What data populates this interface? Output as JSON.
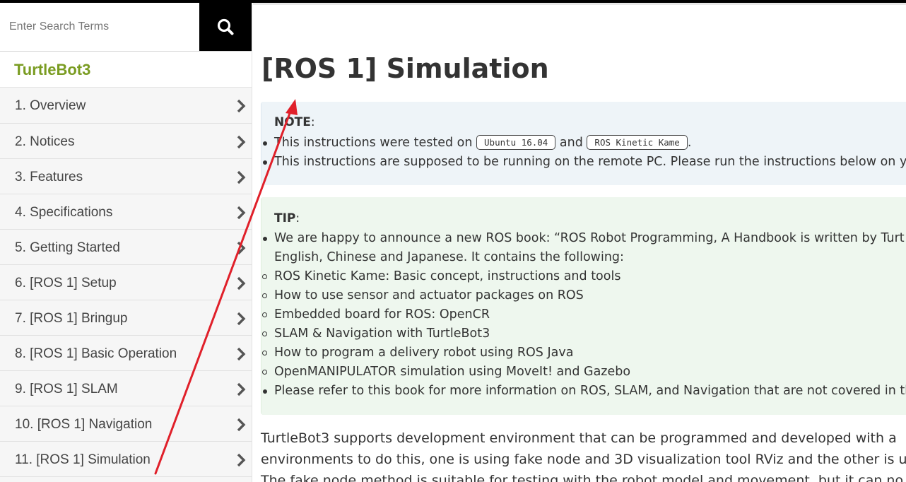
{
  "search": {
    "placeholder": "Enter Search Terms",
    "icon": "search-icon"
  },
  "sidebar": {
    "brand": "TurtleBot3",
    "items": [
      {
        "label": "1. Overview"
      },
      {
        "label": "2. Notices"
      },
      {
        "label": "3. Features"
      },
      {
        "label": "4. Specifications"
      },
      {
        "label": "5. Getting Started"
      },
      {
        "label": "6. [ROS 1] Setup"
      },
      {
        "label": "7. [ROS 1] Bringup"
      },
      {
        "label": "8. [ROS 1] Basic Operation"
      },
      {
        "label": "9. [ROS 1] SLAM"
      },
      {
        "label": "10. [ROS 1] Navigation"
      },
      {
        "label": "11. [ROS 1] Simulation"
      }
    ]
  },
  "main": {
    "title": "[ROS 1] Simulation",
    "note": {
      "heading": "NOTE",
      "line1_pre": "This instructions were tested on",
      "code1": "Ubuntu 16.04",
      "line1_mid": "and",
      "code2": "ROS Kinetic Kame",
      "line1_post": ".",
      "line2": "This instructions are supposed to be running on the remote PC. Please run the instructions below on you"
    },
    "tip": {
      "heading": "TIP",
      "intro_line1": "We are happy to announce a new ROS book:   “ROS Robot Programming, A Handbook is written by Turt",
      "intro_line2": "English, Chinese and Japanese. It contains the following:",
      "sub_items": [
        "ROS Kinetic Kame: Basic concept, instructions and tools",
        "How to use sensor and actuator packages on ROS",
        "Embedded board for ROS: OpenCR",
        "SLAM & Navigation with TurtleBot3",
        "How to program a delivery robot using ROS Java",
        "OpenMANIPULATOR simulation using MoveIt! and Gazebo"
      ],
      "outro": "Please refer to this book for more information on ROS, SLAM, and Navigation that are not covered in thi"
    },
    "body_lines": [
      "TurtleBot3 supports development environment that can be programmed and developed with a",
      "environments to do this, one is using fake node and 3D visualization tool RViz and the other is u",
      "The fake node method is suitable for testing with the robot model and movement, but it can no"
    ]
  },
  "annotation": {
    "color": "#e0202a"
  }
}
